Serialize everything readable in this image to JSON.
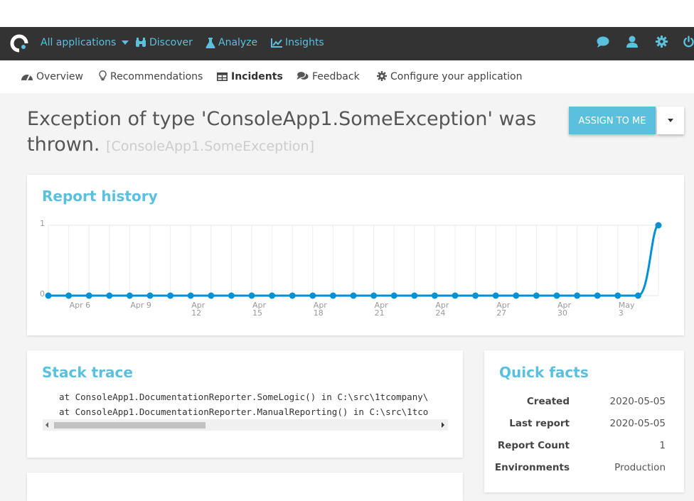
{
  "navbar": {
    "items": [
      {
        "label": "All applications",
        "icon": "caret-down-icon"
      },
      {
        "label": "Discover",
        "icon": "binoculars-icon"
      },
      {
        "label": "Analyze",
        "icon": "flask-icon"
      },
      {
        "label": "Insights",
        "icon": "line-chart-icon"
      }
    ],
    "right_icons": [
      "chat-icon",
      "user-icon",
      "gear-icon",
      "power-icon"
    ],
    "accent_color": "#5bc0de",
    "background_color": "#333333"
  },
  "subnav": {
    "items": [
      {
        "label": "Overview",
        "icon": "dashboard-icon"
      },
      {
        "label": "Recommendations",
        "icon": "lightbulb-icon"
      },
      {
        "label": "Incidents",
        "icon": "table-icon",
        "active": true
      },
      {
        "label": "Feedback",
        "icon": "comments-icon"
      },
      {
        "label": "Configure your application",
        "icon": "cog-icon"
      }
    ]
  },
  "page": {
    "title": "Exception of type 'ConsoleApp1.SomeException' was thrown.",
    "subtitle": "[ConsoleApp1.SomeException]",
    "assign_button": "Assign to me"
  },
  "report_history": {
    "title": "Report history"
  },
  "chart_data": {
    "type": "line",
    "title": "Report history",
    "x": [
      "Apr 5",
      "Apr 6",
      "Apr 7",
      "Apr 8",
      "Apr 9",
      "Apr 10",
      "Apr 11",
      "Apr 12",
      "Apr 13",
      "Apr 14",
      "Apr 15",
      "Apr 16",
      "Apr 17",
      "Apr 18",
      "Apr 19",
      "Apr 20",
      "Apr 21",
      "Apr 22",
      "Apr 23",
      "Apr 24",
      "Apr 25",
      "Apr 26",
      "Apr 27",
      "Apr 28",
      "Apr 29",
      "Apr 30",
      "May 1",
      "May 2",
      "May 3",
      "May 4",
      "May 5"
    ],
    "series": [
      {
        "values": [
          0,
          0,
          0,
          0,
          0,
          0,
          0,
          0,
          0,
          0,
          0,
          0,
          0,
          0,
          0,
          0,
          0,
          0,
          0,
          0,
          0,
          0,
          0,
          0,
          0,
          0,
          0,
          0,
          0,
          0,
          1
        ]
      }
    ],
    "x_tick_labels": [
      {
        "index": 1,
        "lines": [
          "Apr 6"
        ]
      },
      {
        "index": 4,
        "lines": [
          "Apr 9"
        ]
      },
      {
        "index": 7,
        "lines": [
          "Apr",
          "12"
        ]
      },
      {
        "index": 10,
        "lines": [
          "Apr",
          "15"
        ]
      },
      {
        "index": 13,
        "lines": [
          "Apr",
          "18"
        ]
      },
      {
        "index": 16,
        "lines": [
          "Apr",
          "21"
        ]
      },
      {
        "index": 19,
        "lines": [
          "Apr",
          "24"
        ]
      },
      {
        "index": 22,
        "lines": [
          "Apr",
          "27"
        ]
      },
      {
        "index": 25,
        "lines": [
          "Apr",
          "30"
        ]
      },
      {
        "index": 28,
        "lines": [
          "May",
          "3"
        ]
      }
    ],
    "y_ticks": [
      "0",
      "1"
    ],
    "ylim": [
      0,
      1
    ],
    "grid": true,
    "line_color": "#0091d5"
  },
  "stack_trace": {
    "title": "Stack trace",
    "lines": [
      "at ConsoleApp1.DocumentationReporter.SomeLogic() in C:\\src\\1tcompany\\",
      "at ConsoleApp1.DocumentationReporter.ManualReporting() in C:\\src\\1tco"
    ]
  },
  "quick_facts": {
    "title": "Quick facts",
    "rows": [
      {
        "label": "Created",
        "value": "2020-05-05"
      },
      {
        "label": "Last report",
        "value": "2020-05-05"
      },
      {
        "label": "Report Count",
        "value": "1"
      },
      {
        "label": "Environments",
        "value": "Production"
      }
    ]
  }
}
